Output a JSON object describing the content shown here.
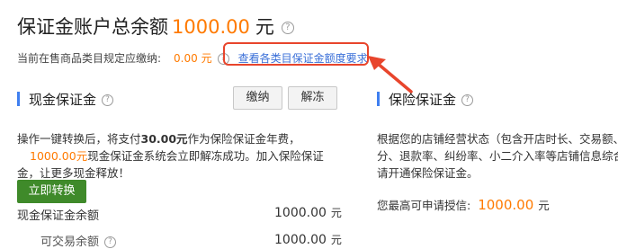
{
  "header": {
    "title": "保证金账户总余额",
    "amount": "1000.00",
    "unit": "元"
  },
  "requirement": {
    "label": "当前在售商品类目规定应缴纳:",
    "value": "0.00 元",
    "link": "查看各类目保证金额度要求"
  },
  "cash_deposit": {
    "title": "现金保证金",
    "pay_button": "缴纳",
    "unfreeze_button": "解冻",
    "description_1": "操作一键转换后，将支付",
    "description_bold": "30.00元",
    "description_2": "作为保险保证金年费，",
    "description_amount": "1000.00元",
    "description_3": "现金保证金系统会立即解冻成功。加入保险保证金，让更多现金释放！",
    "convert_button": "立即转换",
    "balance_label": "现金保证金余额",
    "balance_amount": "1000.00",
    "balance_unit": "元",
    "frozen_label": "可交易余额",
    "frozen_amount": "1000.00",
    "frozen_unit": "元"
  },
  "insurance_deposit": {
    "title": "保险保证金",
    "description_line1": "根据您的店铺经营状态（包含开店时长、交易额、好",
    "description_line2": "分、退款率、纠纷率、小二介入率等店铺信息综合评",
    "description_line3": "请开通保险保证金。",
    "credit_label": "您最高可申请授信:",
    "credit_amount": "1000.00",
    "credit_unit": "元"
  },
  "colors": {
    "accent_orange": "#ff7a00",
    "link_blue": "#3a6fd8",
    "highlight_red": "#e8452c",
    "section_bar_blue": "#3f7ff0",
    "convert_green": "#3f8a2a"
  }
}
